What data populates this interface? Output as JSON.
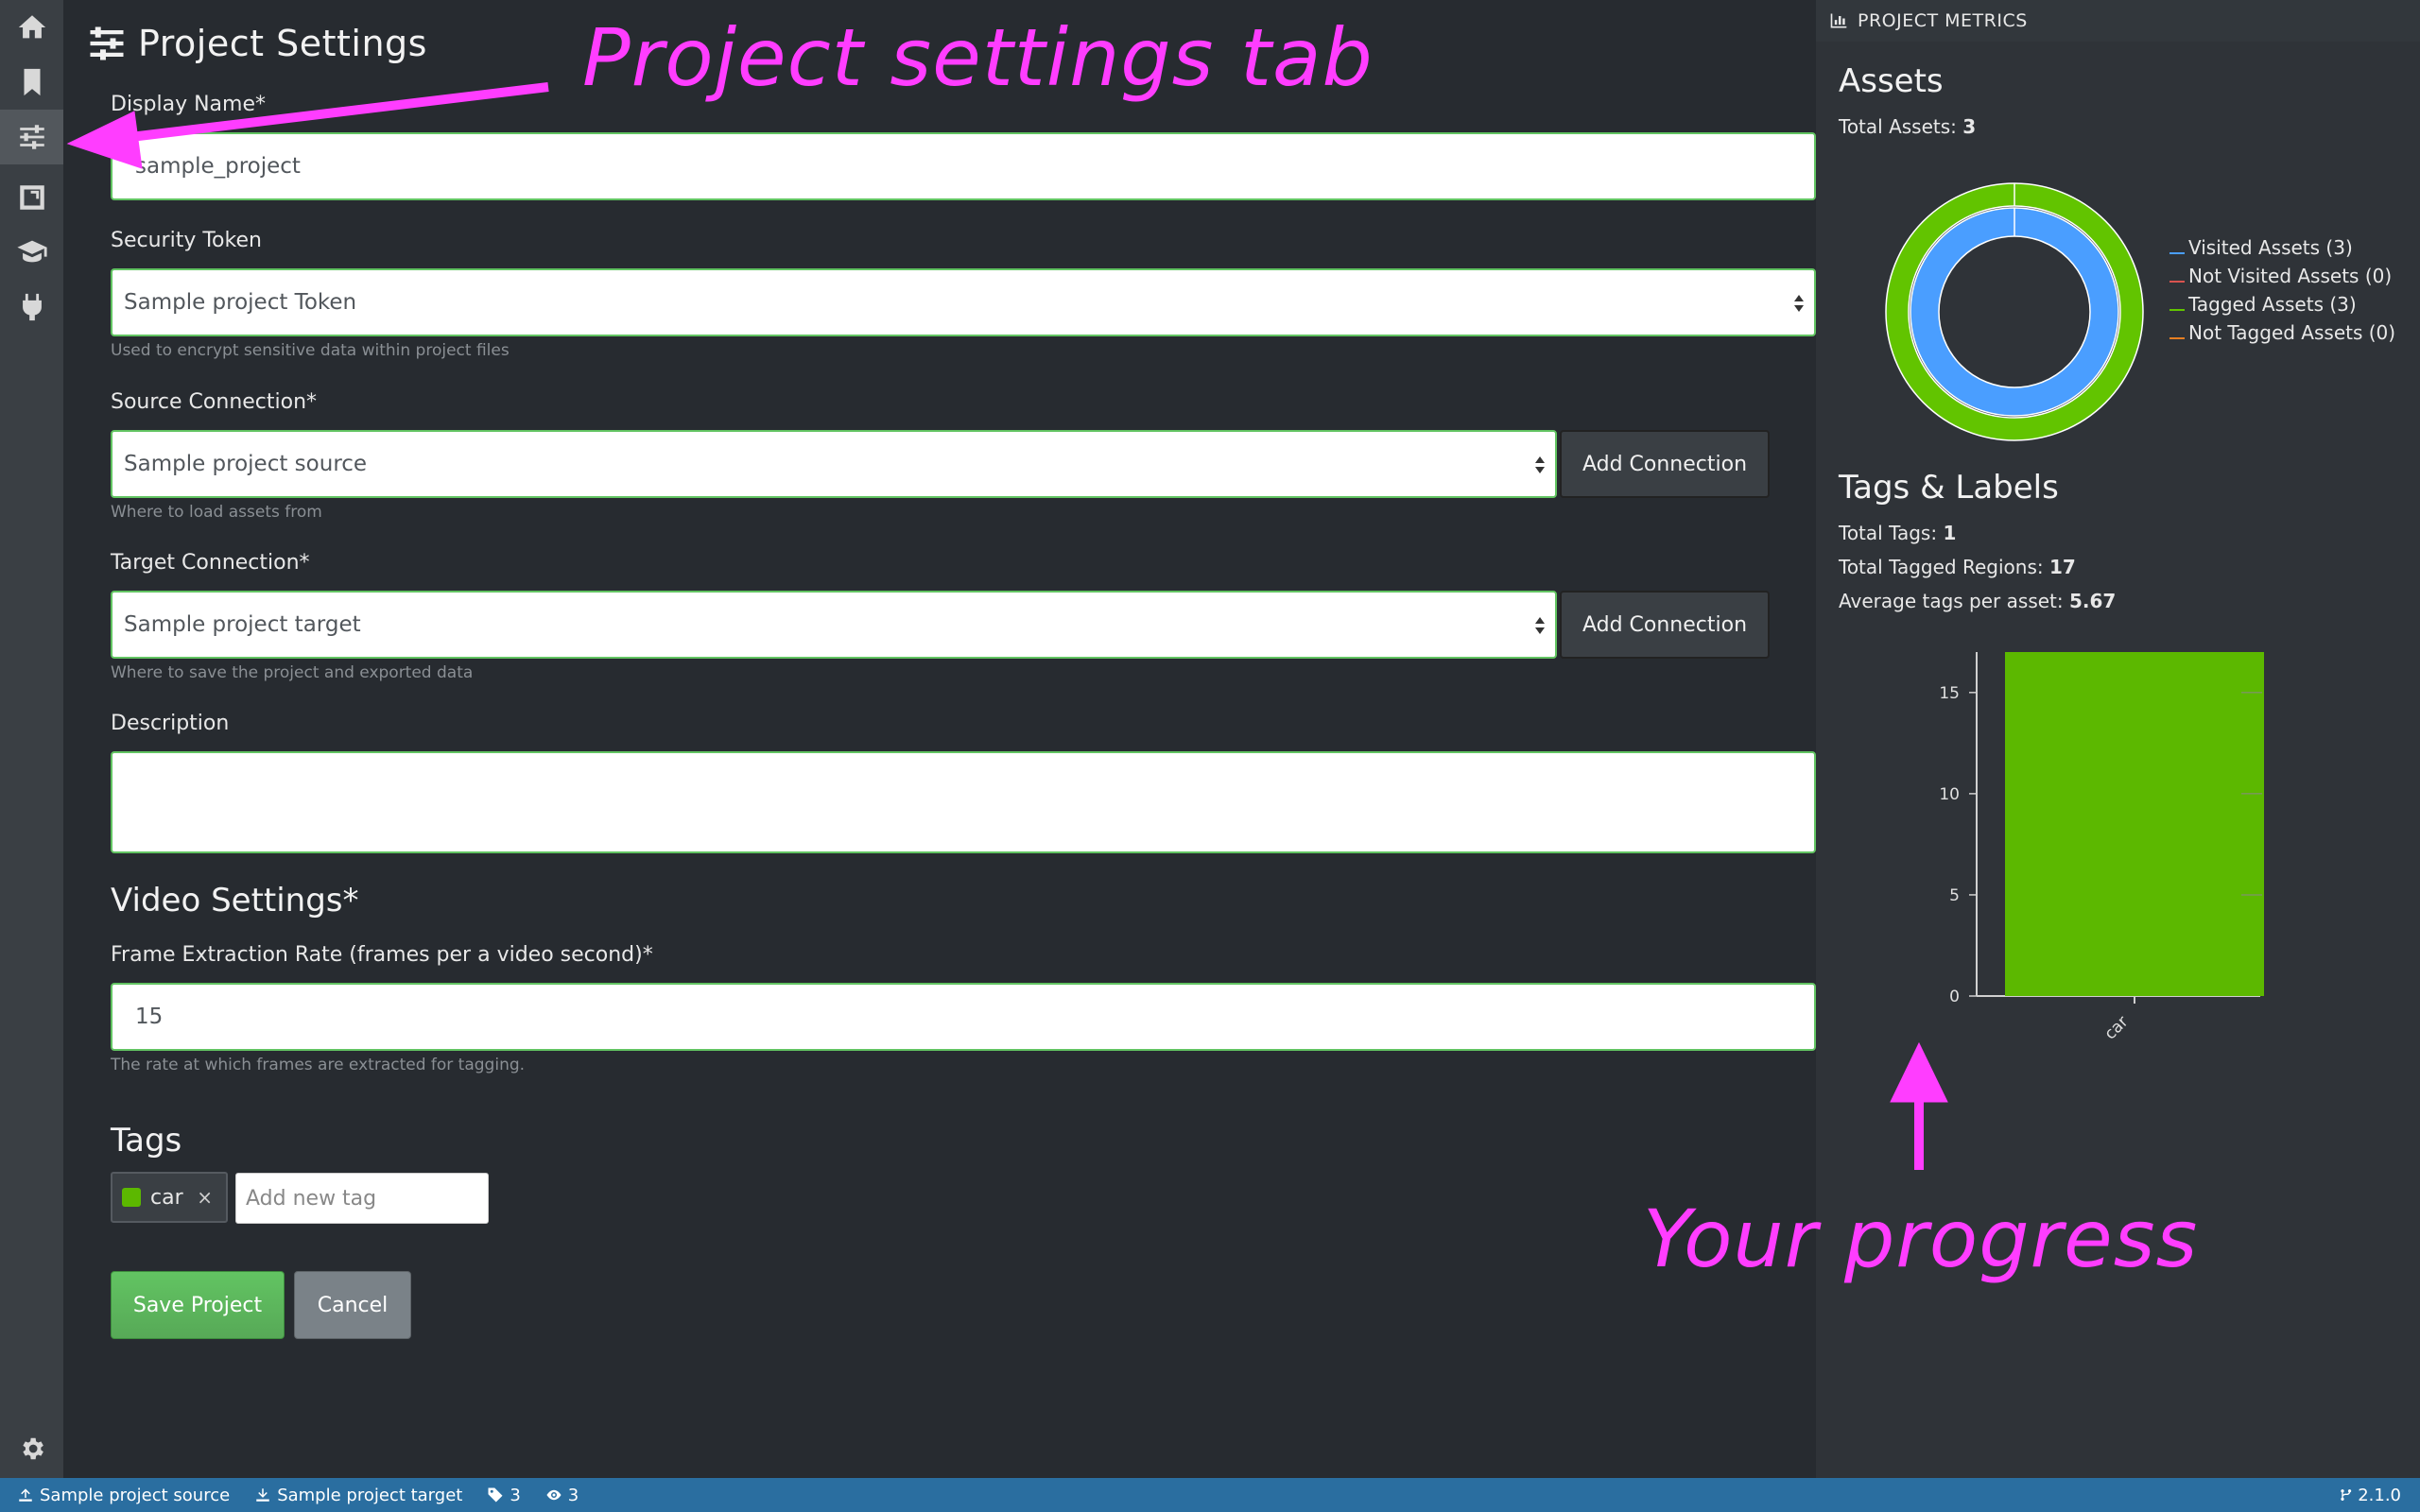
{
  "sidebar": {
    "items": [
      {
        "icon": "home-icon"
      },
      {
        "icon": "bookmark-icon"
      },
      {
        "icon": "sliders-icon",
        "active": true
      },
      {
        "icon": "export-icon"
      },
      {
        "icon": "graduation-cap-icon"
      },
      {
        "icon": "plug-icon"
      }
    ],
    "settings_icon": "gear-icon"
  },
  "page": {
    "title": "Project Settings",
    "display_name": {
      "label": "Display Name*",
      "value": "sample_project"
    },
    "security_token": {
      "label": "Security Token",
      "value": "Sample project Token",
      "hint": "Used to encrypt sensitive data within project files"
    },
    "source_connection": {
      "label": "Source Connection*",
      "value": "Sample project source",
      "hint": "Where to load assets from",
      "button": "Add Connection"
    },
    "target_connection": {
      "label": "Target Connection*",
      "value": "Sample project target",
      "hint": "Where to save the project and exported data",
      "button": "Add Connection"
    },
    "description": {
      "label": "Description",
      "value": ""
    },
    "video_settings": {
      "title": "Video Settings*",
      "label": "Frame Extraction Rate (frames per a video second)*",
      "value": "15",
      "hint": "The rate at which frames are extracted for tagging."
    },
    "tags": {
      "title": "Tags",
      "items": [
        {
          "name": "car",
          "color": "#5cb800",
          "remove": "×"
        }
      ],
      "placeholder": "Add new tag"
    },
    "save_label": "Save Project",
    "cancel_label": "Cancel"
  },
  "metrics": {
    "header": "PROJECT METRICS",
    "assets": {
      "title": "Assets",
      "total_label": "Total Assets:",
      "total": "3",
      "legend": [
        {
          "label": "Visited Assets (3)",
          "color": "#4a9eff"
        },
        {
          "label": "Not Visited Assets (0)",
          "color": "#d9534f"
        },
        {
          "label": "Tagged Assets (3)",
          "color": "#62c400"
        },
        {
          "label": "Not Tagged Assets (0)",
          "color": "#e67e22"
        }
      ]
    },
    "tags": {
      "title": "Tags & Labels",
      "total_tags_label": "Total Tags:",
      "total_tags": "1",
      "tagged_regions_label": "Total Tagged Regions:",
      "tagged_regions": "17",
      "avg_label": "Average tags per asset:",
      "avg": "5.67"
    }
  },
  "chart_data": [
    {
      "type": "pie",
      "rings": [
        {
          "name": "Tagged Assets",
          "slices": [
            {
              "label": "Tagged Assets",
              "value": 3,
              "color": "#62c400"
            },
            {
              "label": "Not Tagged Assets",
              "value": 0,
              "color": "#e67e22"
            }
          ]
        },
        {
          "name": "Visited Assets",
          "slices": [
            {
              "label": "Visited Assets",
              "value": 3,
              "color": "#4a9eff"
            },
            {
              "label": "Not Visited Assets",
              "value": 0,
              "color": "#d9534f"
            }
          ]
        }
      ]
    },
    {
      "type": "bar",
      "categories": [
        "car"
      ],
      "values": [
        17
      ],
      "ylim": [
        0,
        17
      ],
      "yticks": [
        0,
        5,
        10,
        15
      ],
      "color": "#5cb800"
    }
  ],
  "statusbar": {
    "source": "Sample project source",
    "target": "Sample project target",
    "tag_count": "3",
    "visited_count": "3",
    "version": "2.1.0"
  },
  "annotations": {
    "settings_tab": "Project settings tab",
    "progress": "Your progress",
    "color": "#ff3dff"
  }
}
